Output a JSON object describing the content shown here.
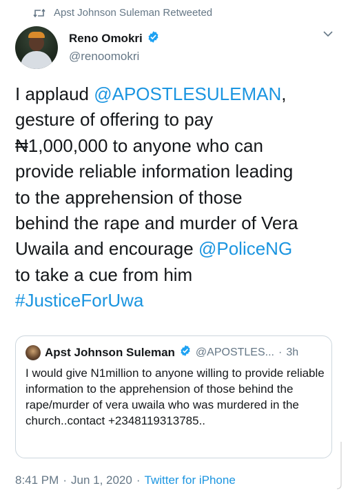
{
  "retweet": {
    "icon": "retweet-icon",
    "label": "Apst Johnson Suleman Retweeted"
  },
  "author": {
    "display_name": "Reno Omokri",
    "handle": "@renoomokri",
    "verified_icon": "verified-badge-icon"
  },
  "tweet": {
    "segments": [
      {
        "text": "I applaud ",
        "type": "text"
      },
      {
        "text": "@APOSTLESULEMAN",
        "type": "mention"
      },
      {
        "text": ",\ngesture of offering to pay\n₦1,000,000 to anyone who can\nprovide reliable information leading\nto the apprehension of those\nbehind the rape and murder of Vera\nUwaila and encourage ",
        "type": "text"
      },
      {
        "text": "@PoliceNG",
        "type": "mention"
      },
      {
        "text": "\nto take a cue from him\n",
        "type": "text"
      },
      {
        "text": "#JusticeForUwa",
        "type": "hashtag"
      }
    ]
  },
  "quoted_tweet": {
    "display_name": "Apst Johnson Suleman",
    "handle": "@APOSTLES...",
    "separator": "·",
    "time": "3h",
    "text": "I would give N1million to anyone willing to provide reliable information to the apprehension of those behind the rape/murder of vera uwaila who was murdered in the church..contact +2348119313785.."
  },
  "footer": {
    "time": "8:41 PM",
    "sep1": "·",
    "date": "Jun 1, 2020",
    "sep2": "·",
    "client": "Twitter for iPhone"
  },
  "colors": {
    "link": "#1b95e0",
    "secondary_text": "#657786",
    "verified": "#1da1f2",
    "border": "#ccd6dd"
  }
}
